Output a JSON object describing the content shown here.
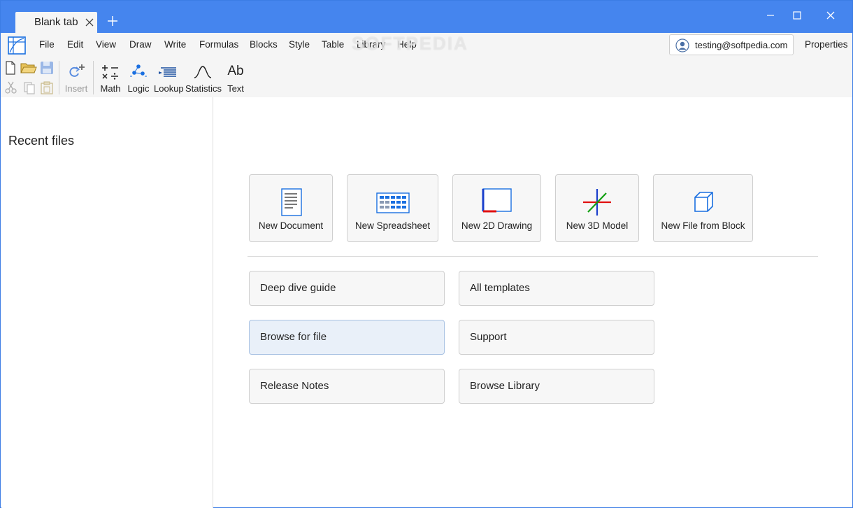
{
  "tab": {
    "title": "Blank tab"
  },
  "menu": [
    "File",
    "Edit",
    "View",
    "Draw",
    "Write",
    "Formulas",
    "Blocks",
    "Style",
    "Table",
    "Library",
    "Help"
  ],
  "watermark": "SOFTPEDIA",
  "account": {
    "email": "testing@softpedia.com"
  },
  "properties_label": "Properties",
  "toolbar": {
    "insert": "Insert",
    "math": "Math",
    "logic": "Logic",
    "lookup": "Lookup",
    "statistics": "Statistics",
    "text": "Text",
    "text_glyph": "Ab"
  },
  "sidebar": {
    "title": "Recent files"
  },
  "cards": {
    "document": "New Document",
    "spreadsheet": "New Spreadsheet",
    "drawing2d": "New 2D Drawing",
    "model3d": "New 3D Model",
    "from_block": "New File from Block"
  },
  "links": {
    "deep_dive": "Deep dive guide",
    "all_templates": "All templates",
    "browse_file": "Browse for file",
    "support": "Support",
    "release_notes": "Release Notes",
    "browse_library": "Browse Library"
  },
  "colors": {
    "titlebar": "#4585ee",
    "accent": "#1a6fe0",
    "chrome": "#f5f5f5"
  }
}
